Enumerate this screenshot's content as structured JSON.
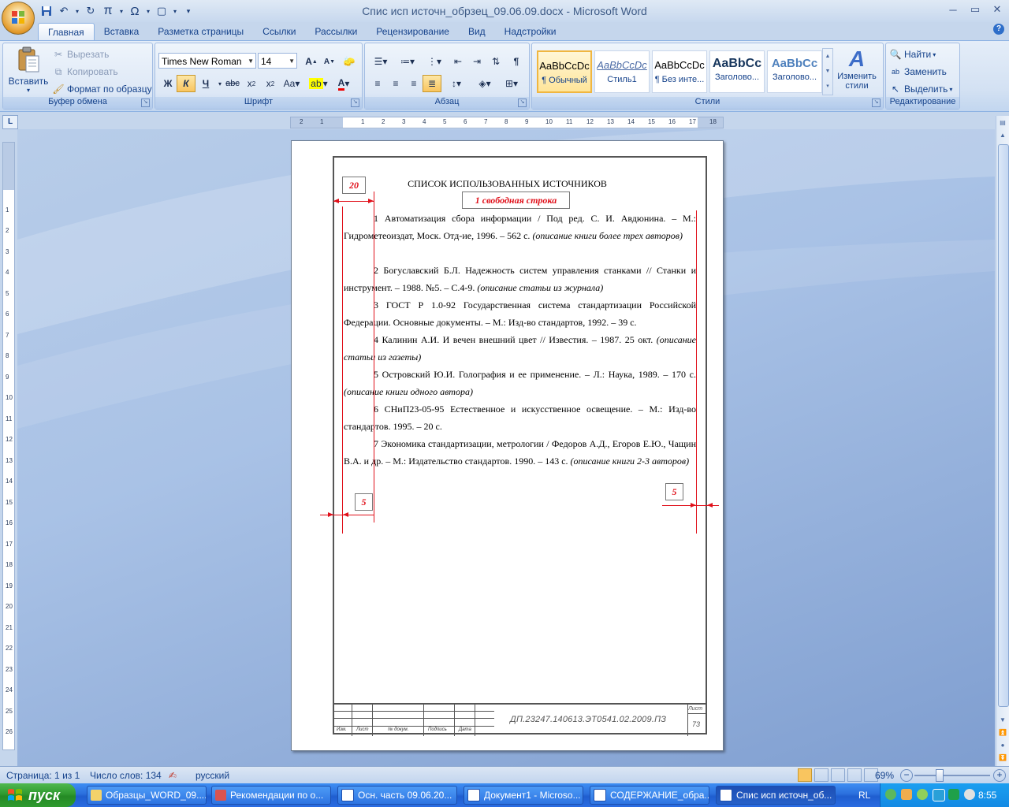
{
  "window": {
    "title": "Спис исп источн_обрзец_09.06.09.docx - Microsoft Word",
    "controls": [
      "minimize",
      "maximize",
      "close"
    ]
  },
  "tabs": [
    "Главная",
    "Вставка",
    "Разметка страницы",
    "Ссылки",
    "Рассылки",
    "Рецензирование",
    "Вид",
    "Надстройки"
  ],
  "ribbon": {
    "clipboard": {
      "label": "Буфер обмена",
      "paste": "Вставить",
      "cut": "Вырезать",
      "copy": "Копировать",
      "format_painter": "Формат по образцу"
    },
    "font": {
      "label": "Шрифт",
      "font_name": "Times New Roman",
      "font_size": "14"
    },
    "paragraph": {
      "label": "Абзац"
    },
    "styles": {
      "label": "Стили",
      "change_styles": "Изменить стили",
      "items": [
        {
          "preview": "AaBbCcDc",
          "name": "¶ Обычный"
        },
        {
          "preview": "AaBbCcDc",
          "name": "Стиль1"
        },
        {
          "preview": "AaBbCcDc",
          "name": "¶ Без инте..."
        },
        {
          "preview": "AaBbCc",
          "name": "Заголово..."
        },
        {
          "preview": "AaBbCc",
          "name": "Заголово..."
        }
      ]
    },
    "editing": {
      "label": "Редактирование",
      "find": "Найти",
      "replace": "Заменить",
      "select": "Выделить"
    }
  },
  "document": {
    "title": "СПИСОК ИСПОЛЬЗОВАННЫХ ИСТОЧНИКОВ",
    "annotations": {
      "margin_top": "20",
      "free_line": "1 свободная строка",
      "margin_left": "5",
      "margin_right": "5"
    },
    "entries": [
      {
        "text": "1 Автоматизация сбора информации / Под ред. С. И. Авдюнина. – М.: Гидрометеоиздат, Моск. Отд-ие, 1996. – 562 с. ",
        "note": "(описание книги более трех авторов)"
      },
      {
        "text": "2 Богуславский Б.Л. Надежность систем управления станками // Станки и инструмент. – 1988. №5. – С.4-9. ",
        "note": "(описание статьи из журнала)"
      },
      {
        "text": "3 ГОСТ Р 1.0-92 Государственная система стандартизации Российской Федерации. Основные документы. – М.: Изд-во стандартов, 1992. – 39 с.",
        "note": ""
      },
      {
        "text": "4 Калинин А.И. И вечен внешний цвет // Известия. – 1987. 25 окт. ",
        "note": "(описание статьи из газеты)"
      },
      {
        "text": "5 Островский Ю.И. Голография и ее применение. – Л.: Наука, 1989. – 170 с. ",
        "note": "(описание книги одного автора)"
      },
      {
        "text": "6 СНиП23-05-95 Естественное и искусственное освещение. – М.: Изд-во стандартов. 1995. – 20 с.",
        "note": ""
      },
      {
        "text": "7 Экономика стандартизации, метрологии / Федоров А.Д., Егоров Е.Ю., Чащин В.А. и др. – М.: Издательство стандартов. 1990. – 143 с. ",
        "note": "(описание книги 2-3 авторов)"
      }
    ],
    "stamp": {
      "code": "ДП.23247.140613.ЭТ0541.02.2009.ПЗ",
      "cols": [
        "Изм.",
        "Лист",
        "№ докум.",
        "Подпись",
        "Дата"
      ],
      "sheet_label": "Лист",
      "sheet_number": "73"
    }
  },
  "statusbar": {
    "page": "Страница: 1 из 1",
    "words": "Число слов: 134",
    "language": "русский",
    "zoom": "69%"
  },
  "taskbar": {
    "start": "пуск",
    "tasks": [
      "Образцы_WORD_09....",
      "Рекомендации по о...",
      "Осн. часть 09.06.20...",
      "Документ1 - Microso...",
      "СОДЕРЖАНИЕ_обра...",
      "Спис исп источн_об..."
    ],
    "lang": "RL",
    "clock": "8:55"
  },
  "colors": {
    "accent": "#15428b",
    "annotation_red": "#e0101a",
    "taskbar": "#2b6fdd",
    "start": "#2f9a2f"
  }
}
